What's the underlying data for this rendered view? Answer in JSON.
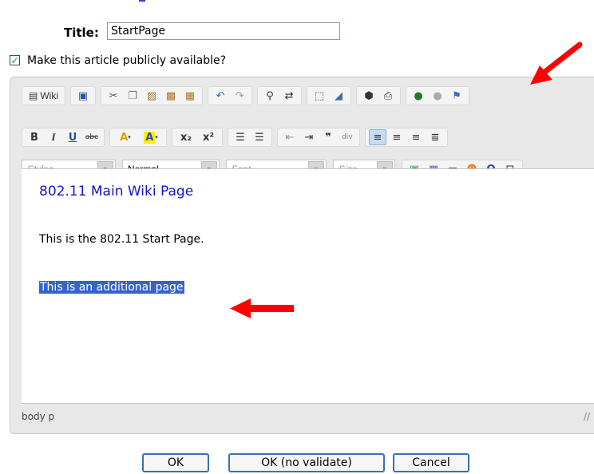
{
  "form": {
    "title_label": "Title:",
    "title_value": "StartPage",
    "public_label": "Make this article publicly available?",
    "public_checked": true
  },
  "toolbar": {
    "row1": {
      "wiki_label": "Wiki",
      "icons": [
        "save-icon",
        "cut-icon",
        "copy-icon",
        "paste-icon",
        "paste-text-icon",
        "paste-word-icon",
        "undo-icon",
        "redo-icon",
        "find-icon",
        "replace-icon",
        "select-all-icon",
        "remove-format-icon",
        "template-icon",
        "preview-icon",
        "link-icon",
        "unlink-icon",
        "anchor-icon"
      ]
    },
    "row2": {
      "bold": "B",
      "italic": "I",
      "underline": "U",
      "strike": "abc",
      "text_color": "A",
      "bg_color": "A",
      "subscript": "x₂",
      "superscript": "x²",
      "align_left_active": true
    },
    "row3": {
      "styles_placeholder": "Styles",
      "format_value": "Normal",
      "font_placeholder": "Font",
      "size_placeholder": "Size"
    }
  },
  "content": {
    "heading": "802.11 Main Wiki Page",
    "paragraph1": "This is the 802.11 Start Page.",
    "paragraph2": "This is an additional page"
  },
  "status": {
    "path": "body  p"
  },
  "buttons": {
    "ok": "OK",
    "ok_no_validate": "OK (no validate)",
    "cancel": "Cancel"
  },
  "colors": {
    "heading": "#1515c9",
    "selection": "#3563c9",
    "arrow": "#ff0000",
    "button_border": "#3a6fb4"
  }
}
